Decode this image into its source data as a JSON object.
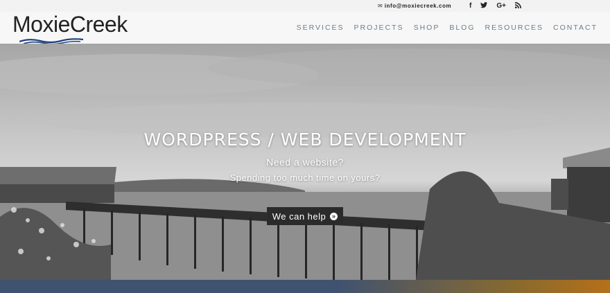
{
  "topbar": {
    "email": "info@moxiecreek.com",
    "social": [
      {
        "icon": "facebook-icon",
        "glyph": "f"
      },
      {
        "icon": "twitter-icon",
        "glyph": "t"
      },
      {
        "icon": "google-plus-icon",
        "glyph": "G+"
      },
      {
        "icon": "rss-icon",
        "glyph": "rss"
      }
    ]
  },
  "header": {
    "logo": "MoxieCreek",
    "nav": [
      "SERVICES",
      "PROJECTS",
      "SHOP",
      "BLOG",
      "RESOURCES",
      "CONTACT"
    ]
  },
  "hero": {
    "title": "WORDPRESS / WEB DEVELOPMENT",
    "subtitle1": "Need a website?",
    "subtitle2": "Spending too much time on yours?",
    "cta": "We can help"
  },
  "colors": {
    "nav": "#6b7d8a",
    "band_left": "#3f5270",
    "band_right": "#b5701a"
  }
}
